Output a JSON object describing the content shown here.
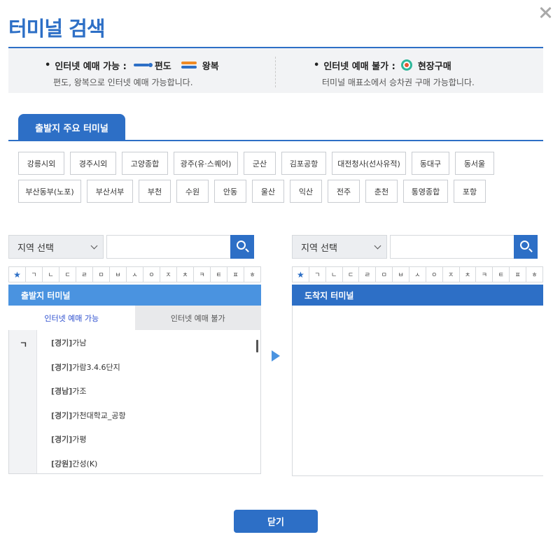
{
  "title": "터미널 검색",
  "info": {
    "left_head_1": "인터넷 예매 가능 :",
    "oneway_label": "편도",
    "round_label": "왕복",
    "left_sub": "편도, 왕복으로 인터넷 예매 가능합니다.",
    "right_head_1": "인터넷 예매 불가 :",
    "onsite_label": "현장구매",
    "right_sub": "터미널 매표소에서 승차권 구매 가능합니다.",
    "bullet": "•"
  },
  "main_tab": "출발지 주요 터미널",
  "terminals_row1": [
    "강릉시외",
    "경주시외",
    "고양종합",
    "광주(유·스퀘어)",
    "군산",
    "김포공항",
    "대전청사(선사유적)",
    "동대구",
    "동서울"
  ],
  "terminals_row2": [
    "부산동부(노포)",
    "부산서부",
    "부천",
    "수원",
    "안동",
    "울산",
    "익산",
    "전주",
    "춘천",
    "통영종합",
    "포항"
  ],
  "region_select": "지역 선택",
  "index_chars": [
    "★",
    "ㄱ",
    "ㄴ",
    "ㄷ",
    "ㄹ",
    "ㅁ",
    "ㅂ",
    "ㅅ",
    "ㅇ",
    "ㅈ",
    "ㅊ",
    "ㅋ",
    "ㅌ",
    "ㅍ",
    "ㅎ"
  ],
  "departure": {
    "header": "출발지 터미널",
    "tab_online": "인터넷 예매 가능",
    "tab_offline": "인터넷 예매 불가",
    "letter": "ㄱ",
    "entries": [
      {
        "region": "[경기]",
        "name": "가남"
      },
      {
        "region": "[경기]",
        "name": "가람3.4.6단지"
      },
      {
        "region": "[경남]",
        "name": "가조"
      },
      {
        "region": "[경기]",
        "name": "가천대학교_공항"
      },
      {
        "region": "[경기]",
        "name": "가평"
      },
      {
        "region": "[강원]",
        "name": "간성(K)"
      }
    ]
  },
  "arrival": {
    "header": "도착지 터미널"
  },
  "close_button": "닫기",
  "colors": {
    "primary": "#2d6fc6",
    "light_primary": "#4a93e0",
    "oneway": "#2d6fc6",
    "round_top": "#f08a24",
    "onsite_ring": "#2fb79a",
    "onsite_center": "#e8542f"
  },
  "icons": {
    "close": "close-icon",
    "search": "search-icon",
    "arrow": "arrow-right-icon"
  }
}
